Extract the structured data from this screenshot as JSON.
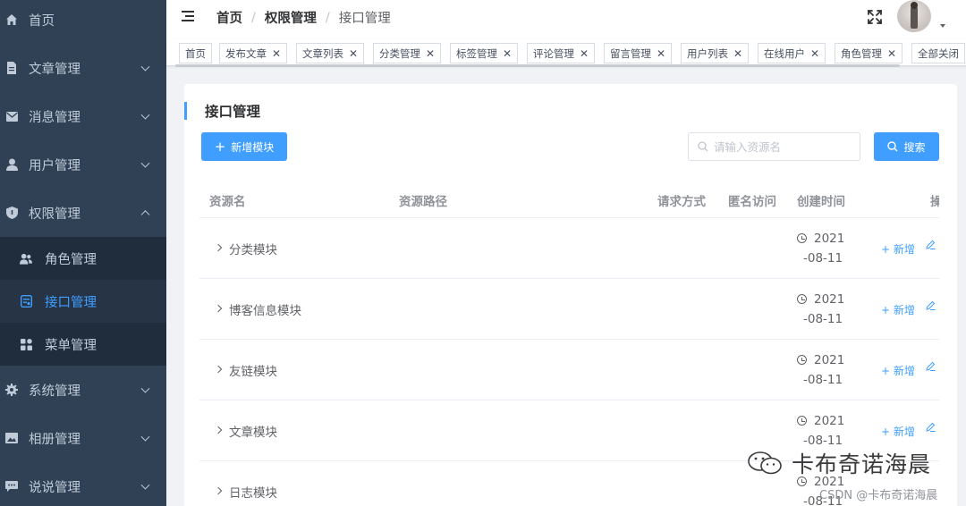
{
  "sidebar": {
    "items": [
      {
        "label": "首页",
        "icon": "home-icon"
      },
      {
        "label": "文章管理",
        "icon": "document-icon"
      },
      {
        "label": "消息管理",
        "icon": "mail-icon"
      },
      {
        "label": "用户管理",
        "icon": "user-icon"
      },
      {
        "label": "权限管理",
        "icon": "shield-icon"
      },
      {
        "label": "系统管理",
        "icon": "gear-icon"
      },
      {
        "label": "相册管理",
        "icon": "picture-icon"
      },
      {
        "label": "说说管理",
        "icon": "chat-icon"
      }
    ],
    "submenu": [
      {
        "label": "角色管理",
        "icon": "users-icon"
      },
      {
        "label": "接口管理",
        "icon": "api-icon"
      },
      {
        "label": "菜单管理",
        "icon": "menu-grid-icon"
      }
    ]
  },
  "header": {
    "breadcrumb": [
      "首页",
      "权限管理",
      "接口管理"
    ],
    "separator": "/"
  },
  "tags": [
    "首页",
    "发布文章",
    "文章列表",
    "分类管理",
    "标签管理",
    "评论管理",
    "留言管理",
    "用户列表",
    "在线用户",
    "角色管理",
    "全部关闭"
  ],
  "tag_close": "✕",
  "main": {
    "title": "接口管理",
    "add_button": "新增模块",
    "search_placeholder": "请输入资源名",
    "search_button": "搜索"
  },
  "table": {
    "columns": [
      "资源名",
      "资源路径",
      "请求方式",
      "匿名访问",
      "创建时间",
      "操作"
    ],
    "rows": [
      {
        "name": "分类模块",
        "time_1": "2021",
        "time_2": "-08-11"
      },
      {
        "name": "博客信息模块",
        "time_1": "2021",
        "time_2": "-08-11"
      },
      {
        "name": "友链模块",
        "time_1": "2021",
        "time_2": "-08-11"
      },
      {
        "name": "文章模块",
        "time_1": "2021",
        "time_2": "-08-11"
      },
      {
        "name": "日志模块",
        "time_1": "2021",
        "time_2": "-08-11"
      }
    ],
    "op_add": "新增"
  },
  "watermark": {
    "text": "卡布奇诺海晨",
    "csdn": "CSDN @卡布奇诺海晨"
  },
  "colors": {
    "sidebar_bg": "#304156",
    "active": "#409eff",
    "primary": "#409eff"
  }
}
